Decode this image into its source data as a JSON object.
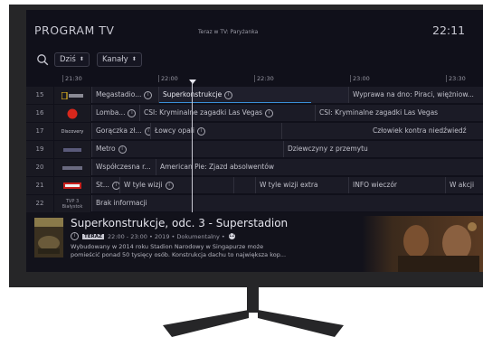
{
  "header": {
    "title": "PROGRAM TV",
    "now_label": "Teraz w TV: Paryżanka",
    "clock": "22:11"
  },
  "filters": {
    "day": "Dziś",
    "channels": "Kanały"
  },
  "timeline": {
    "ticks": [
      "21:30",
      "22:00",
      "22:30",
      "23:00",
      "23:30"
    ]
  },
  "channels": [
    {
      "number": "15",
      "logo": "National Geographic",
      "programs": [
        {
          "title": "Megastadio...",
          "info": true
        },
        {
          "title": "Superkonstrukcje",
          "info": true,
          "selected": true
        },
        {
          "title": "Wyprawa na dno: Piraci, więżniow...",
          "info": false
        }
      ]
    },
    {
      "number": "16",
      "logo": "Polsat Crime",
      "programs": [
        {
          "title": "Lomba...",
          "info": true
        },
        {
          "title": "CSI: Kryminalne zagadki Las Vegas",
          "info": true
        },
        {
          "title": "CSI: Kryminalne zagadki Las Vegas",
          "info": false
        }
      ]
    },
    {
      "number": "17",
      "logo": "Discovery",
      "programs": [
        {
          "title": "Gorączka zł...",
          "info": true
        },
        {
          "title": "Łowcy opali",
          "info": true
        },
        {
          "title": "Człowiek kontra niedźwiedź",
          "info": false
        }
      ]
    },
    {
      "number": "19",
      "logo": "Channel 19",
      "programs": [
        {
          "title": "Metro",
          "info": true
        },
        {
          "title": "Dziewczyny z przemytu",
          "info": false
        }
      ]
    },
    {
      "number": "20",
      "logo": "Channel 20",
      "programs": [
        {
          "title": "Współczesna r...",
          "info": false
        },
        {
          "title": "American Pie: Zjazd absolwentów",
          "info": false
        }
      ]
    },
    {
      "number": "21",
      "logo": "TVN24",
      "programs": [
        {
          "title": "St...",
          "info": true
        },
        {
          "title": "W tyle wizji",
          "info": true
        },
        {
          "title": "W tyle wizji extra",
          "info": false
        },
        {
          "title": "INFO wieczór",
          "info": false
        },
        {
          "title": "W akcji",
          "info": false
        }
      ]
    },
    {
      "number": "22",
      "logo_line1": "TVP 3",
      "logo_line2": "Białystok",
      "programs": [
        {
          "title": "Brak informacji",
          "info": false
        }
      ]
    }
  ],
  "detail": {
    "title": "Superkonstrukcje, odc. 3 - Superstadion",
    "badge": "TERAZ",
    "meta": "22:00 - 23:00 • 2019 • Dokumentalny •",
    "age_rating": "12",
    "description_line1": "Wybudowany w 2014 roku Stadion Narodowy w Singapurze może",
    "description_line2": "pomieścić ponad 50 tysięcy osób. Konstrukcja dachu to największa kop..."
  },
  "colors": {
    "accent": "#3a8fd8",
    "background": "#10101a",
    "bezel": "#262628"
  }
}
